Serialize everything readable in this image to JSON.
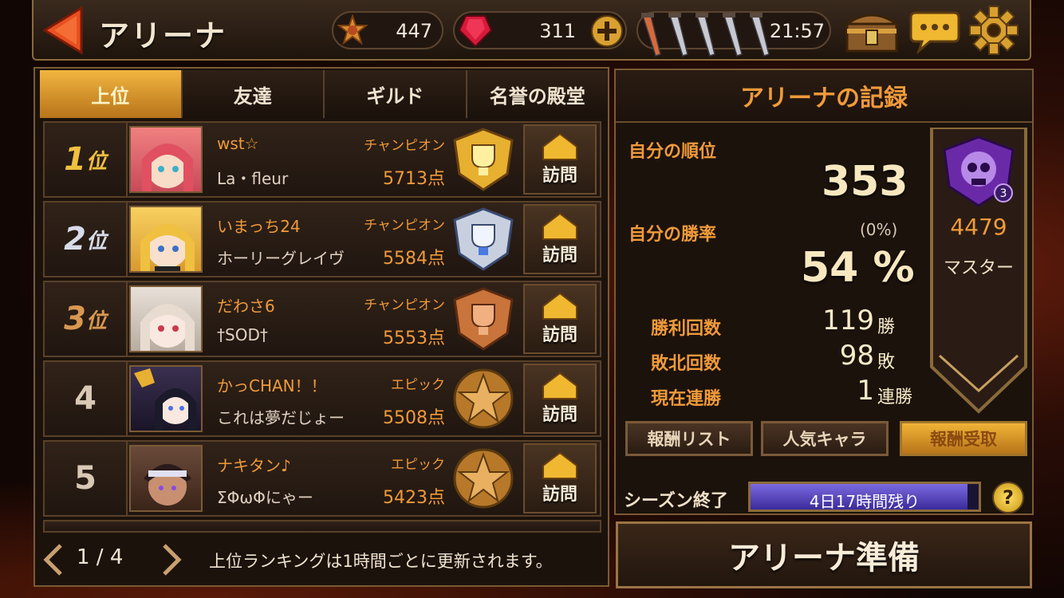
{
  "header": {
    "title": "アリーナ",
    "medals": "447",
    "gems": "311",
    "stamina_timer": "21:57"
  },
  "tabs": [
    {
      "label": "上位"
    },
    {
      "label": "友達"
    },
    {
      "label": "ギルド"
    },
    {
      "label": "名誉の殿堂"
    }
  ],
  "rankings": [
    {
      "rank": "1",
      "rank_suffix": "位",
      "name": "wst☆",
      "guild": "La・fleur",
      "tier": "チャンピオン",
      "score": "5713点",
      "visit": "訪問"
    },
    {
      "rank": "2",
      "rank_suffix": "位",
      "name": "いまっち24",
      "guild": "ホーリーグレイヴ",
      "tier": "チャンピオン",
      "score": "5584点",
      "visit": "訪問"
    },
    {
      "rank": "3",
      "rank_suffix": "位",
      "name": "だわさ6",
      "guild": "†SOD†",
      "tier": "チャンピオン",
      "score": "5553点",
      "visit": "訪問"
    },
    {
      "rank": "4",
      "rank_suffix": "",
      "name": "かっCHAN！！",
      "guild": "これは夢だじょー",
      "tier": "エピック",
      "score": "5508点",
      "visit": "訪問"
    },
    {
      "rank": "5",
      "rank_suffix": "",
      "name": "ナキタン♪",
      "guild": "ΣΦωΦにゃー",
      "tier": "エピック",
      "score": "5423点",
      "visit": "訪問"
    }
  ],
  "footer": {
    "page": "1 / 4",
    "note": "上位ランキングは1時間ごとに更新されます。"
  },
  "record": {
    "title": "アリーナの記録",
    "my_rank_label": "自分の順位",
    "my_rank": "353",
    "win_rate_label": "自分の勝率",
    "win_rate_delta": "(0%)",
    "win_rate": "54 %",
    "wins_label": "勝利回数",
    "wins": "119",
    "wins_unit": "勝",
    "losses_label": "敗北回数",
    "losses": "98",
    "losses_unit": "敗",
    "streak_label": "現在連勝",
    "streak": "1",
    "streak_unit": "連勝",
    "league_points": "4479",
    "league_name": "マスター",
    "league_level": "3",
    "btn_rewards_list": "報酬リスト",
    "btn_popular": "人気キャラ",
    "btn_claim": "報酬受取",
    "season_label": "シーズン終了",
    "season_remaining": "4日17時間残り",
    "season_progress": 0.95,
    "help": "?"
  },
  "prepare_button": "アリーナ準備",
  "colors": {
    "accent": "#f09a3a",
    "gold_tab": "#f2b540",
    "border": "#7a5a34"
  }
}
